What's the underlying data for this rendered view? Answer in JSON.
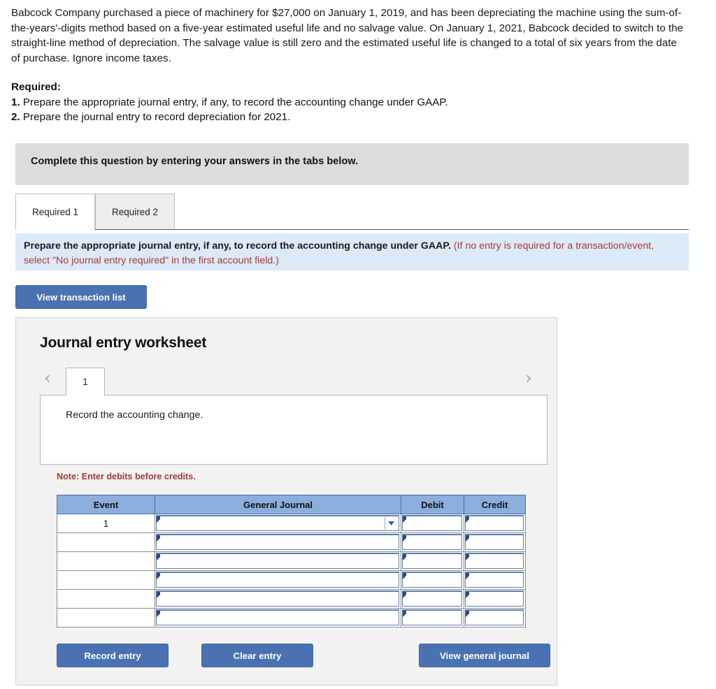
{
  "problem": {
    "paragraph": "Babcock Company purchased a piece of machinery for $27,000 on January 1, 2019, and has been depreciating the machine using the sum-of-the-years'-digits method based on a five-year estimated useful life and no salvage value. On January 1, 2021, Babcock decided to switch to the straight-line method of depreciation. The salvage value is still zero and the estimated useful life is changed to a total of six years from the date of purchase. Ignore income taxes.",
    "required_label": "Required:",
    "requirements": [
      {
        "number": "1.",
        "text": "Prepare the appropriate journal entry, if any, to record the accounting change under GAAP."
      },
      {
        "number": "2.",
        "text": "Prepare the journal entry to record depreciation for 2021."
      }
    ]
  },
  "instruction_banner": {
    "text": "Complete this question by entering your answers in the tabs below."
  },
  "tabs": [
    {
      "label": "Required 1",
      "active": true
    },
    {
      "label": "Required 2",
      "active": false
    }
  ],
  "task_banner": {
    "main": "Prepare the appropriate journal entry, if any, to record the accounting change under GAAP.",
    "hint": "(If no entry is required for a transaction/event, select \"No journal entry required\" in the first account field.)"
  },
  "buttons": {
    "view_transaction_list": "View transaction list",
    "record_entry": "Record entry",
    "clear_entry": "Clear entry",
    "view_general_journal": "View general journal"
  },
  "worksheet": {
    "title": "Journal entry worksheet",
    "prev_icon": "chevron-left-icon",
    "next_icon": "chevron-right-icon",
    "page_tabs": [
      {
        "label": "1",
        "active": true
      }
    ],
    "description": "Record the accounting change.",
    "note": "Note: Enter debits before credits.",
    "table": {
      "headers": [
        "Event",
        "General Journal",
        "Debit",
        "Credit"
      ],
      "rows": [
        {
          "event": "1",
          "general_journal": "",
          "debit": "",
          "credit": "",
          "has_dropdown": true
        },
        {
          "event": "",
          "general_journal": "",
          "debit": "",
          "credit": "",
          "has_dropdown": false
        },
        {
          "event": "",
          "general_journal": "",
          "debit": "",
          "credit": "",
          "has_dropdown": false
        },
        {
          "event": "",
          "general_journal": "",
          "debit": "",
          "credit": "",
          "has_dropdown": false
        },
        {
          "event": "",
          "general_journal": "",
          "debit": "",
          "credit": "",
          "has_dropdown": false
        },
        {
          "event": "",
          "general_journal": "",
          "debit": "",
          "credit": "",
          "has_dropdown": false
        }
      ]
    }
  },
  "colors": {
    "button_blue": "#4a72b2",
    "table_header_blue": "#8baedc",
    "info_banner_blue": "#dce9f7",
    "instruction_gray": "#dcdcdc",
    "note_red": "#9d3b3b",
    "hint_red": "#a83a3a",
    "panel_gray": "#f2f2f2"
  }
}
